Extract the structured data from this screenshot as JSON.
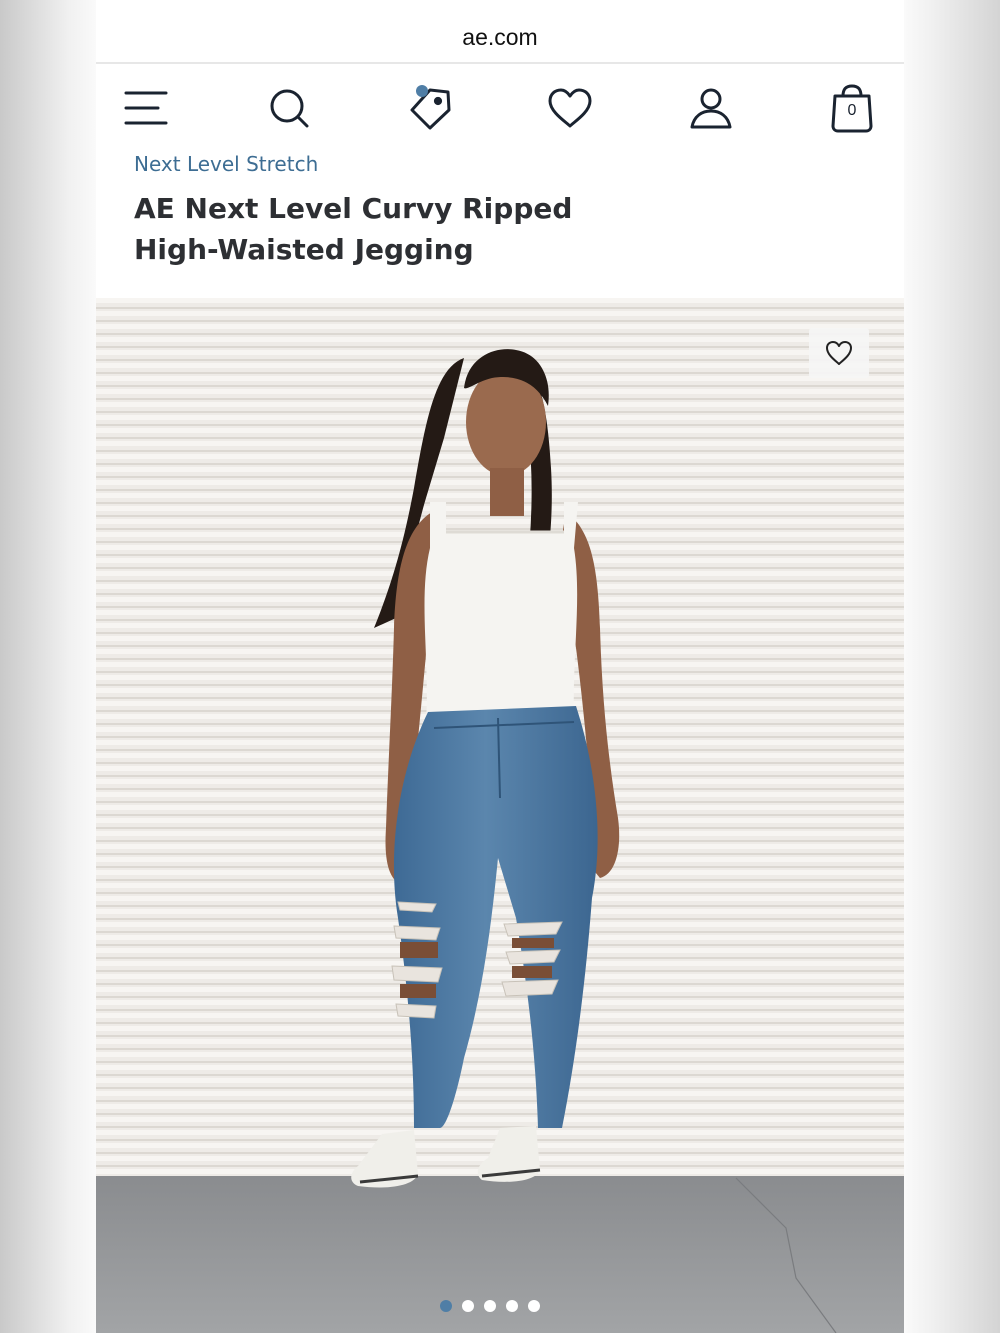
{
  "browser": {
    "url": "ae.com"
  },
  "nav": {
    "menu_icon": "hamburger-menu-icon",
    "search_icon": "search-icon",
    "deals_icon": "tag-icon",
    "favorites_icon": "heart-icon",
    "account_icon": "user-icon",
    "bag_icon": "shopping-bag-icon",
    "bag_count": "0"
  },
  "product": {
    "collection": "Next Level Stretch",
    "title": "AE Next Level Curvy Ripped High-Waisted Jegging"
  },
  "gallery": {
    "favorite_icon": "heart-outline-icon",
    "slide_count": 5,
    "active_slide": 1
  },
  "colors": {
    "accent_blue": "#3d6d93",
    "title_text": "#2d2f33",
    "icon_navy": "#1a2330",
    "notification_dot": "#4f7ea6"
  }
}
